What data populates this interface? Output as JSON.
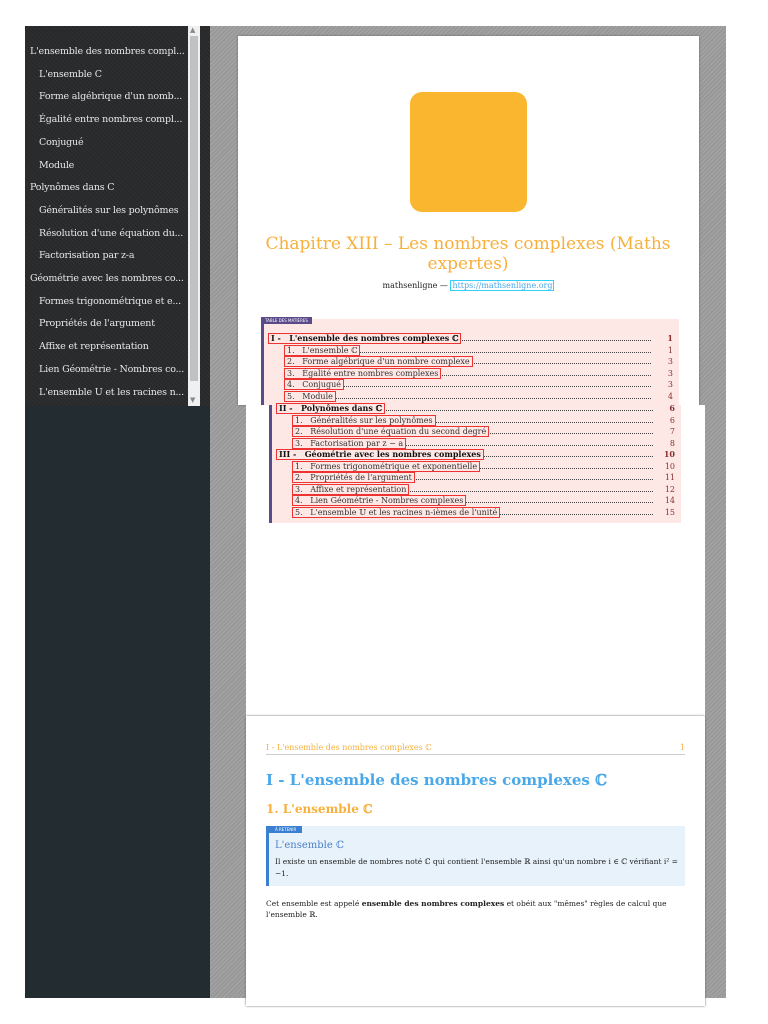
{
  "outline": [
    {
      "label": "L'ensemble des nombres compl...",
      "level": 0
    },
    {
      "label": "L'ensemble C",
      "level": 1
    },
    {
      "label": "Forme algébrique d'un nomb...",
      "level": 1
    },
    {
      "label": "Égalité entre nombres compl...",
      "level": 1
    },
    {
      "label": "Conjugué",
      "level": 1
    },
    {
      "label": "Module",
      "level": 1
    },
    {
      "label": "Polynômes dans C",
      "level": 0
    },
    {
      "label": "Généralités sur les polynômes",
      "level": 1
    },
    {
      "label": "Résolution d'une équation du...",
      "level": 1
    },
    {
      "label": "Factorisation par z-a",
      "level": 1
    },
    {
      "label": "Géométrie avec les nombres co...",
      "level": 0
    },
    {
      "label": "Formes trigonométrique et e...",
      "level": 1
    },
    {
      "label": "Propriétés de l'argument",
      "level": 1
    },
    {
      "label": "Affixe et représentation",
      "level": 1
    },
    {
      "label": "Lien Géométrie - Nombres co...",
      "level": 1
    },
    {
      "label": "L'ensemble U et les racines n...",
      "level": 1
    }
  ],
  "cover": {
    "title": "Chapitre XIII – Les nombres complexes (Maths expertes)",
    "author": "mathsenligne",
    "sep": "—",
    "link": "https://mathsenligne.org",
    "logo_color": "#fbb62f"
  },
  "toc": {
    "label": "TABLE DES MATIÈRES",
    "items": [
      {
        "num": "I -",
        "title": "L'ensemble des nombres complexes ℂ",
        "page": "1",
        "part": true
      },
      {
        "num": "1.",
        "title": "L'ensemble ℂ",
        "page": "1"
      },
      {
        "num": "2.",
        "title": "Forme algébrique d'un nombre complexe",
        "page": "3"
      },
      {
        "num": "3.",
        "title": "Égalité entre nombres complexes",
        "page": "3"
      },
      {
        "num": "4.",
        "title": "Conjugué",
        "page": "3"
      },
      {
        "num": "5.",
        "title": "Module",
        "page": "4"
      },
      {
        "num": "II -",
        "title": "Polynômes dans ℂ",
        "page": "6",
        "part": true
      },
      {
        "num": "1.",
        "title": "Généralités sur les polynômes",
        "page": "6"
      },
      {
        "num": "2.",
        "title": "Résolution d'une équation du second degré",
        "page": "7"
      },
      {
        "num": "3.",
        "title": "Factorisation par z − a",
        "page": "8"
      },
      {
        "num": "III -",
        "title": "Géométrie avec les nombres complexes",
        "page": "10",
        "part": true
      },
      {
        "num": "1.",
        "title": "Formes trigonométrique et exponentielle",
        "page": "10"
      },
      {
        "num": "2.",
        "title": "Propriétés de l'argument",
        "page": "11"
      },
      {
        "num": "3.",
        "title": "Affixe et représentation",
        "page": "12"
      },
      {
        "num": "4.",
        "title": "Lien Géométrie - Nombres complexes",
        "page": "14"
      },
      {
        "num": "5.",
        "title": "L'ensemble 𝕌 et les racines n-ièmes de l'unité",
        "page": "15"
      }
    ]
  },
  "page2": {
    "header_left": "I - L'ensemble des nombres complexes ℂ",
    "header_right": "1",
    "h1": "I - L'ensemble des nombres complexes ℂ",
    "h2": "1. L'ensemble ℂ",
    "def_tag": "À RETENIR",
    "def_title": "L'ensemble ℂ",
    "def_text": "Il existe un ensemble de nombres noté ℂ qui contient l'ensemble ℝ ainsi qu'un nombre i ∈ ℂ vérifiant i² = −1.",
    "para_1": "Cet ensemble est appelé ",
    "para_bold": "ensemble des nombres complexes",
    "para_2": " et obéit aux \"mêmes\" règles de calcul que l'ensemble ℝ."
  }
}
